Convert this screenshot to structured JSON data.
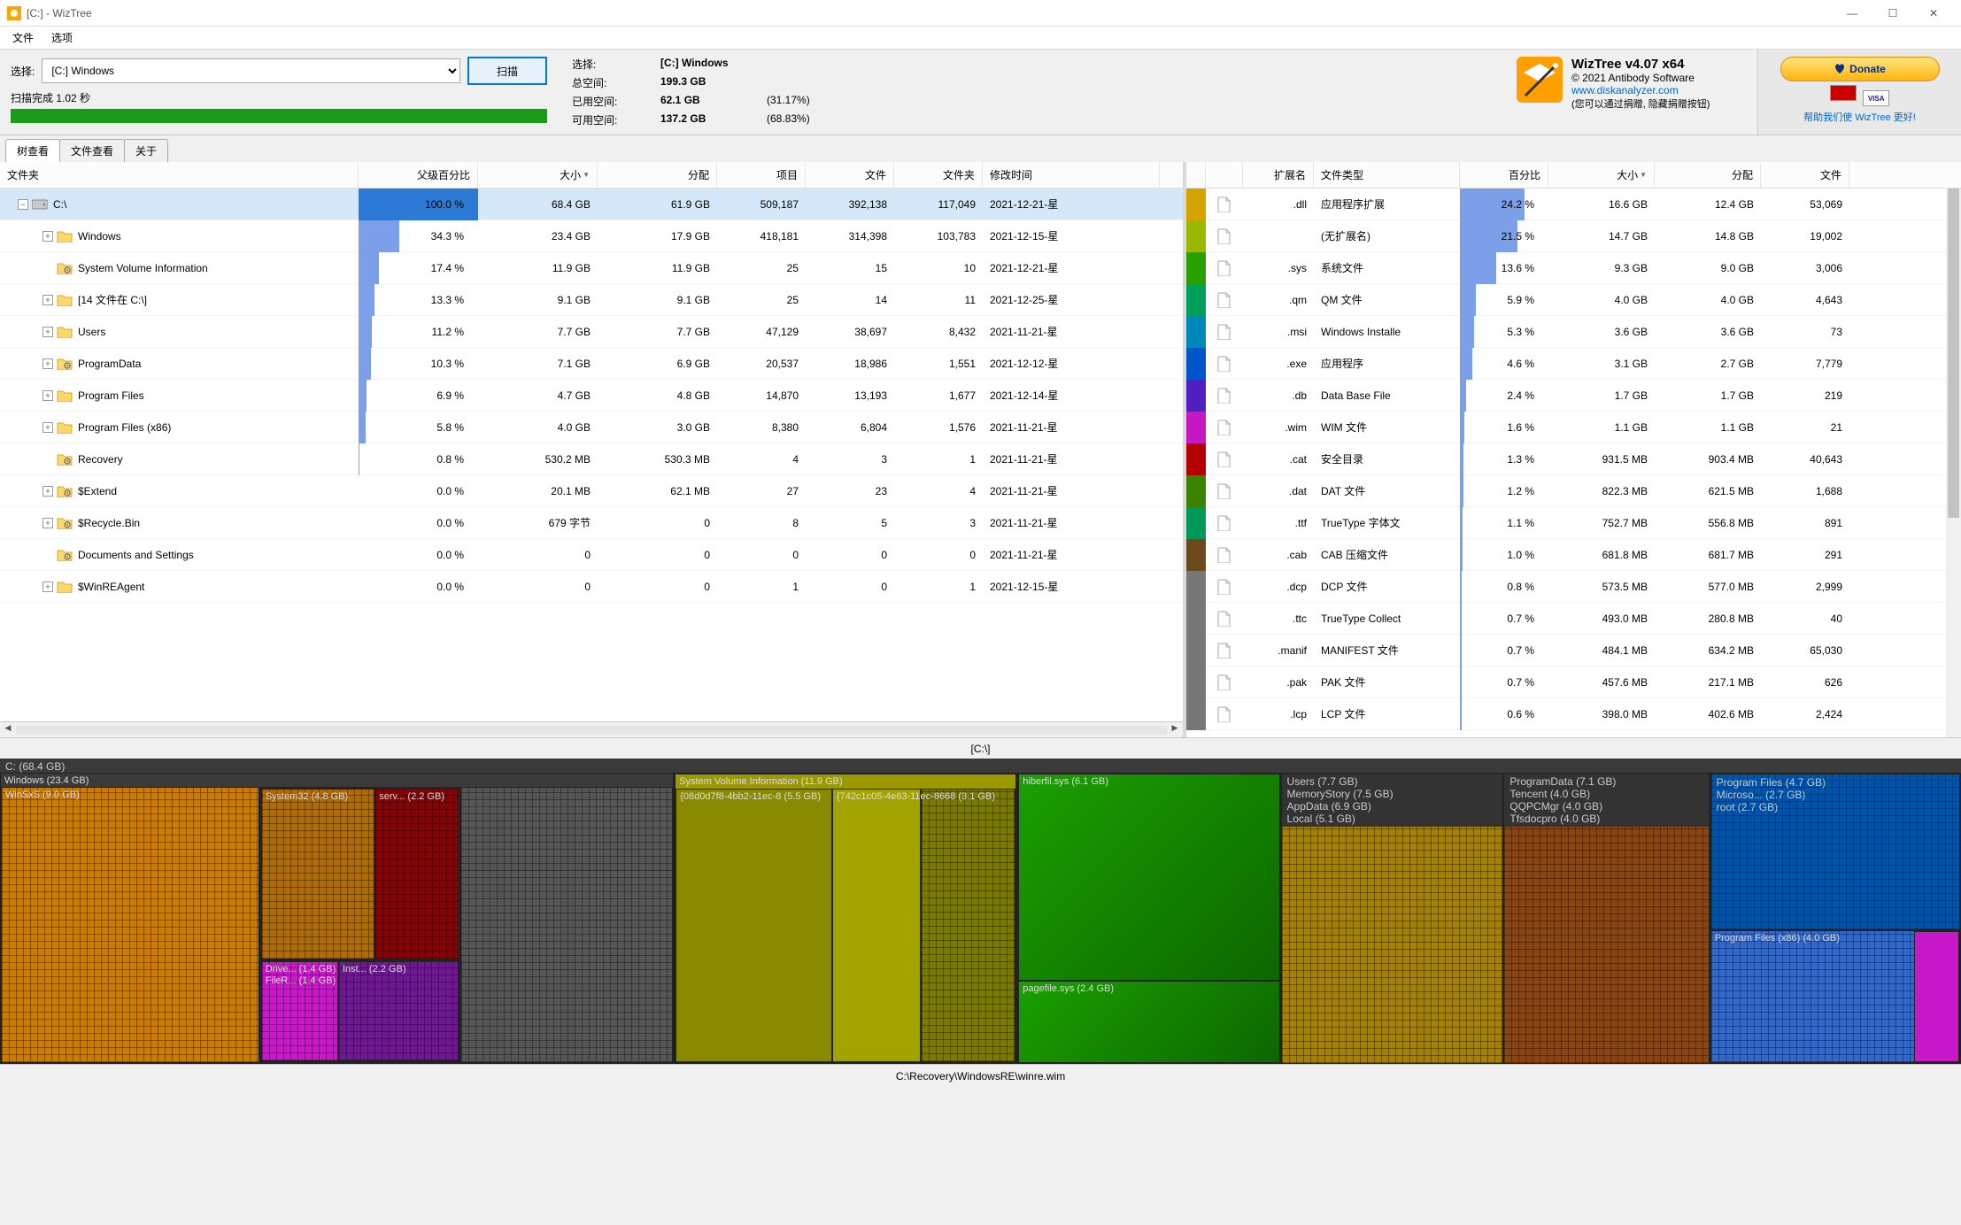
{
  "window": {
    "title": "[C:]  - WizTree",
    "minimize": "—",
    "maximize": "☐",
    "close": "✕"
  },
  "menu": {
    "file": "文件",
    "options": "选项"
  },
  "scan": {
    "select_label": "选择:",
    "drive": "[C:] Windows",
    "scan_btn": "扫描",
    "status": "扫描完成 1.02 秒"
  },
  "disk_info": {
    "select_label": "选择:",
    "drive": "[C:]  Windows",
    "total_label": "总空间:",
    "total_val": "199.3 GB",
    "used_label": "已用空间:",
    "used_val": "62.1 GB",
    "used_pct": "(31.17%)",
    "free_label": "可用空间:",
    "free_val": "137.2 GB",
    "free_pct": "(68.83%)"
  },
  "branding": {
    "title": "WizTree v4.07 x64",
    "copyright": "© 2021 Antibody Software",
    "url": "www.diskanalyzer.com",
    "note": "(您可以通过捐赠, 隐藏捐赠按钮)"
  },
  "donate": {
    "btn": "Donate",
    "help": "帮助我们使 WizTree 更好!"
  },
  "tabs": {
    "tree": "树查看",
    "file": "文件查看",
    "about": "关于"
  },
  "tree_cols": {
    "folder": "文件夹",
    "pct": "父级百分比",
    "size": "大小",
    "alloc": "分配",
    "items": "项目",
    "files": "文件",
    "folders": "文件夹",
    "modified": "修改时间"
  },
  "tree_rows": [
    {
      "indent": 0,
      "exp": "−",
      "icon": "drive",
      "name": "C:\\",
      "pct": "100.0 %",
      "pctv": 100,
      "size": "68.4 GB",
      "alloc": "61.9 GB",
      "items": "509,187",
      "files": "392,138",
      "folders": "117,049",
      "mod": "2021-12-21-星",
      "sel": true
    },
    {
      "indent": 1,
      "exp": "+",
      "icon": "folder",
      "name": "Windows",
      "pct": "34.3 %",
      "pctv": 34.3,
      "size": "23.4 GB",
      "alloc": "17.9 GB",
      "items": "418,181",
      "files": "314,398",
      "folders": "103,783",
      "mod": "2021-12-15-星"
    },
    {
      "indent": 1,
      "exp": "",
      "icon": "gear",
      "name": "System Volume Information",
      "pct": "17.4 %",
      "pctv": 17.4,
      "size": "11.9 GB",
      "alloc": "11.9 GB",
      "items": "25",
      "files": "15",
      "folders": "10",
      "mod": "2021-12-21-星"
    },
    {
      "indent": 1,
      "exp": "+",
      "icon": "folder",
      "name": "[14 文件在 C:\\]",
      "pct": "13.3 %",
      "pctv": 13.3,
      "size": "9.1 GB",
      "alloc": "9.1 GB",
      "items": "25",
      "files": "14",
      "folders": "11",
      "mod": "2021-12-25-星"
    },
    {
      "indent": 1,
      "exp": "+",
      "icon": "folder",
      "name": "Users",
      "pct": "11.2 %",
      "pctv": 11.2,
      "size": "7.7 GB",
      "alloc": "7.7 GB",
      "items": "47,129",
      "files": "38,697",
      "folders": "8,432",
      "mod": "2021-11-21-星"
    },
    {
      "indent": 1,
      "exp": "+",
      "icon": "gear",
      "name": "ProgramData",
      "pct": "10.3 %",
      "pctv": 10.3,
      "size": "7.1 GB",
      "alloc": "6.9 GB",
      "items": "20,537",
      "files": "18,986",
      "folders": "1,551",
      "mod": "2021-12-12-星"
    },
    {
      "indent": 1,
      "exp": "+",
      "icon": "folder",
      "name": "Program Files",
      "pct": "6.9 %",
      "pctv": 6.9,
      "size": "4.7 GB",
      "alloc": "4.8 GB",
      "items": "14,870",
      "files": "13,193",
      "folders": "1,677",
      "mod": "2021-12-14-星"
    },
    {
      "indent": 1,
      "exp": "+",
      "icon": "folder",
      "name": "Program Files (x86)",
      "pct": "5.8 %",
      "pctv": 5.8,
      "size": "4.0 GB",
      "alloc": "3.0 GB",
      "items": "8,380",
      "files": "6,804",
      "folders": "1,576",
      "mod": "2021-11-21-星"
    },
    {
      "indent": 1,
      "exp": "",
      "icon": "gear",
      "name": "Recovery",
      "pct": "0.8 %",
      "pctv": 0.8,
      "size": "530.2 MB",
      "alloc": "530.3 MB",
      "items": "4",
      "files": "3",
      "folders": "1",
      "mod": "2021-11-21-星"
    },
    {
      "indent": 1,
      "exp": "+",
      "icon": "gear",
      "name": "$Extend",
      "pct": "0.0 %",
      "pctv": 0,
      "size": "20.1 MB",
      "alloc": "62.1 MB",
      "items": "27",
      "files": "23",
      "folders": "4",
      "mod": "2021-11-21-星"
    },
    {
      "indent": 1,
      "exp": "+",
      "icon": "gear",
      "name": "$Recycle.Bin",
      "pct": "0.0 %",
      "pctv": 0,
      "size": "679 字节",
      "alloc": "0",
      "items": "8",
      "files": "5",
      "folders": "3",
      "mod": "2021-11-21-星"
    },
    {
      "indent": 1,
      "exp": "",
      "icon": "gear",
      "name": "Documents and Settings",
      "pct": "0.0 %",
      "pctv": 0,
      "size": "0",
      "alloc": "0",
      "items": "0",
      "files": "0",
      "folders": "0",
      "mod": "2021-11-21-星"
    },
    {
      "indent": 1,
      "exp": "+",
      "icon": "folder",
      "name": "$WinREAgent",
      "pct": "0.0 %",
      "pctv": 0,
      "size": "0",
      "alloc": "0",
      "items": "1",
      "files": "0",
      "folders": "1",
      "mod": "2021-12-15-星"
    }
  ],
  "ext_cols": {
    "ext": "扩展名",
    "type": "文件类型",
    "pct": "百分比",
    "size": "大小",
    "alloc": "分配",
    "files": "文件"
  },
  "ext_rows": [
    {
      "color": "#d6a400",
      "ext": ".dll",
      "type": "应用程序扩展",
      "pct": "24.2 %",
      "pctv": 24.2,
      "size": "16.6 GB",
      "alloc": "12.4 GB",
      "files": "53,069"
    },
    {
      "color": "#9bb800",
      "ext": "",
      "type": "(无扩展名)",
      "pct": "21.5 %",
      "pctv": 21.5,
      "size": "14.7 GB",
      "alloc": "14.8 GB",
      "files": "19,002"
    },
    {
      "color": "#2aa000",
      "ext": ".sys",
      "type": "系统文件",
      "pct": "13.6 %",
      "pctv": 13.6,
      "size": "9.3 GB",
      "alloc": "9.0 GB",
      "files": "3,006"
    },
    {
      "color": "#00a05c",
      "ext": ".qm",
      "type": "QM 文件",
      "pct": "5.9 %",
      "pctv": 5.9,
      "size": "4.0 GB",
      "alloc": "4.0 GB",
      "files": "4,643"
    },
    {
      "color": "#0087ba",
      "ext": ".msi",
      "type": "Windows Installe",
      "pct": "5.3 %",
      "pctv": 5.3,
      "size": "3.6 GB",
      "alloc": "3.6 GB",
      "files": "73"
    },
    {
      "color": "#0054c9",
      "ext": ".exe",
      "type": "应用程序",
      "pct": "4.6 %",
      "pctv": 4.6,
      "size": "3.1 GB",
      "alloc": "2.7 GB",
      "files": "7,779"
    },
    {
      "color": "#4f1fbf",
      "ext": ".db",
      "type": "Data Base File",
      "pct": "2.4 %",
      "pctv": 2.4,
      "size": "1.7 GB",
      "alloc": "1.7 GB",
      "files": "219"
    },
    {
      "color": "#c318c3",
      "ext": ".wim",
      "type": "WIM 文件",
      "pct": "1.6 %",
      "pctv": 1.6,
      "size": "1.1 GB",
      "alloc": "1.1 GB",
      "files": "21"
    },
    {
      "color": "#b40000",
      "ext": ".cat",
      "type": "安全目录",
      "pct": "1.3 %",
      "pctv": 1.3,
      "size": "931.5 MB",
      "alloc": "903.4 MB",
      "files": "40,643"
    },
    {
      "color": "#3a8200",
      "ext": ".dat",
      "type": "DAT 文件",
      "pct": "1.2 %",
      "pctv": 1.2,
      "size": "822.3 MB",
      "alloc": "621.5 MB",
      "files": "1,688"
    },
    {
      "color": "#009958",
      "ext": ".ttf",
      "type": "TrueType 字体文",
      "pct": "1.1 %",
      "pctv": 1.1,
      "size": "752.7 MB",
      "alloc": "556.8 MB",
      "files": "891"
    },
    {
      "color": "#6b4a1d",
      "ext": ".cab",
      "type": "CAB 压缩文件",
      "pct": "1.0 %",
      "pctv": 1.0,
      "size": "681.8 MB",
      "alloc": "681.7 MB",
      "files": "291"
    },
    {
      "color": "#777777",
      "ext": ".dcp",
      "type": "DCP 文件",
      "pct": "0.8 %",
      "pctv": 0.8,
      "size": "573.5 MB",
      "alloc": "577.0 MB",
      "files": "2,999"
    },
    {
      "color": "#777777",
      "ext": ".ttc",
      "type": "TrueType Collect",
      "pct": "0.7 %",
      "pctv": 0.7,
      "size": "493.0 MB",
      "alloc": "280.8 MB",
      "files": "40"
    },
    {
      "color": "#777777",
      "ext": ".manif",
      "type": "MANIFEST 文件",
      "pct": "0.7 %",
      "pctv": 0.7,
      "size": "484.1 MB",
      "alloc": "634.2 MB",
      "files": "65,030"
    },
    {
      "color": "#777777",
      "ext": ".pak",
      "type": "PAK 文件",
      "pct": "0.7 %",
      "pctv": 0.7,
      "size": "457.6 MB",
      "alloc": "217.1 MB",
      "files": "626"
    },
    {
      "color": "#777777",
      "ext": ".lcp",
      "type": "LCP 文件",
      "pct": "0.6 %",
      "pctv": 0.6,
      "size": "398.0 MB",
      "alloc": "402.6 MB",
      "files": "2,424"
    }
  ],
  "treemap_title": "[C:\\]",
  "treemap": {
    "root_label": "C: (68.4 GB)",
    "labels": {
      "windows": "Windows (23.4 GB)",
      "winsxs": "WinSxS (9.0 GB)",
      "system32": "System32 (4.8 GB)",
      "serv": "serv... (2.2 GB)",
      "drive": "Drive... (1.4 GB)",
      "filer": "FileR... (1.4 GB)",
      "inst": "Inst... (2.2 GB)",
      "svi": "System Volume Information (11.9 GB)",
      "svi_g1": "{08d0d7f8-4bb2-11ec-8 (5.5 GB)",
      "svi_g2": "{742c1c05-4e63-11ec-8668 (3.1 GB)",
      "hiberfil": "hiberfil.sys (6.1 GB)",
      "pagefile": "pagefile.sys (2.4 GB)",
      "users": "Users (7.7 GB)",
      "memorystory": "MemoryStory (7.5 GB)",
      "appdata": "AppData (6.9 GB)",
      "local": "Local (5.1 GB)",
      "programdata": "ProgramData (7.1 GB)",
      "tencent": "Tencent (4.0 GB)",
      "qqpcmgr": "QQPCMgr (4.0 GB)",
      "tfsdocpro": "Tfsdocpro (4.0 GB)",
      "programfiles": "Program Files (4.7 GB)",
      "microso": "Microso... (2.7 GB)",
      "root": "root (2.7 GB)",
      "programfiles86": "Program Files (x86) (4.0 GB)"
    }
  },
  "statusbar": "C:\\Recovery\\WindowsRE\\winre.wim"
}
